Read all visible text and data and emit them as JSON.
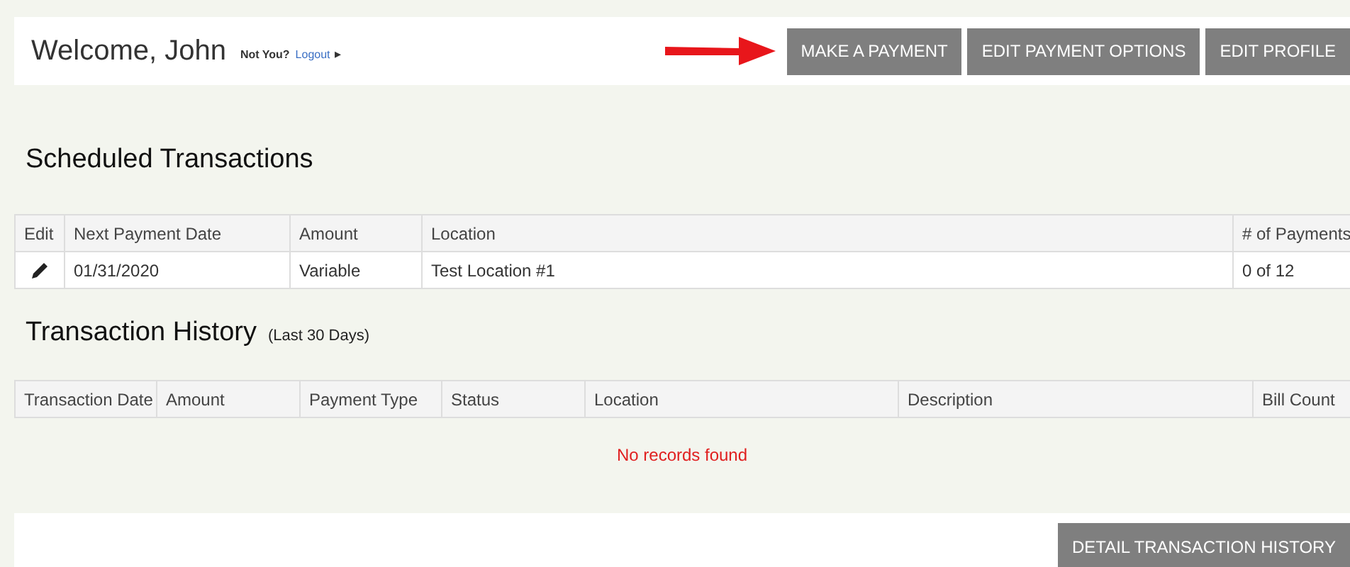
{
  "header": {
    "greeting": "Welcome, John",
    "not_you": "Not You?",
    "logout": "Logout",
    "logout_arrow": "▸"
  },
  "nav_buttons": [
    "MAKE A PAYMENT",
    "EDIT PAYMENT OPTIONS",
    "EDIT PROFILE"
  ],
  "scheduled": {
    "title": "Scheduled Transactions",
    "columns": [
      "Edit",
      "Next Payment Date",
      "Amount",
      "Location",
      "# of Payments"
    ],
    "rows": [
      {
        "next_payment_date": "01/31/2020",
        "amount": "Variable",
        "location": "Test Location #1",
        "payments": "0 of 12"
      }
    ]
  },
  "history": {
    "title": "Transaction History",
    "subtitle": "(Last 30 Days)",
    "columns": [
      "Transaction Date",
      "Amount",
      "Payment Type",
      "Status",
      "Location",
      "Description",
      "Bill Count"
    ],
    "empty_message": "No records found"
  },
  "footer_button": "DETAIL TRANSACTION HISTORY"
}
